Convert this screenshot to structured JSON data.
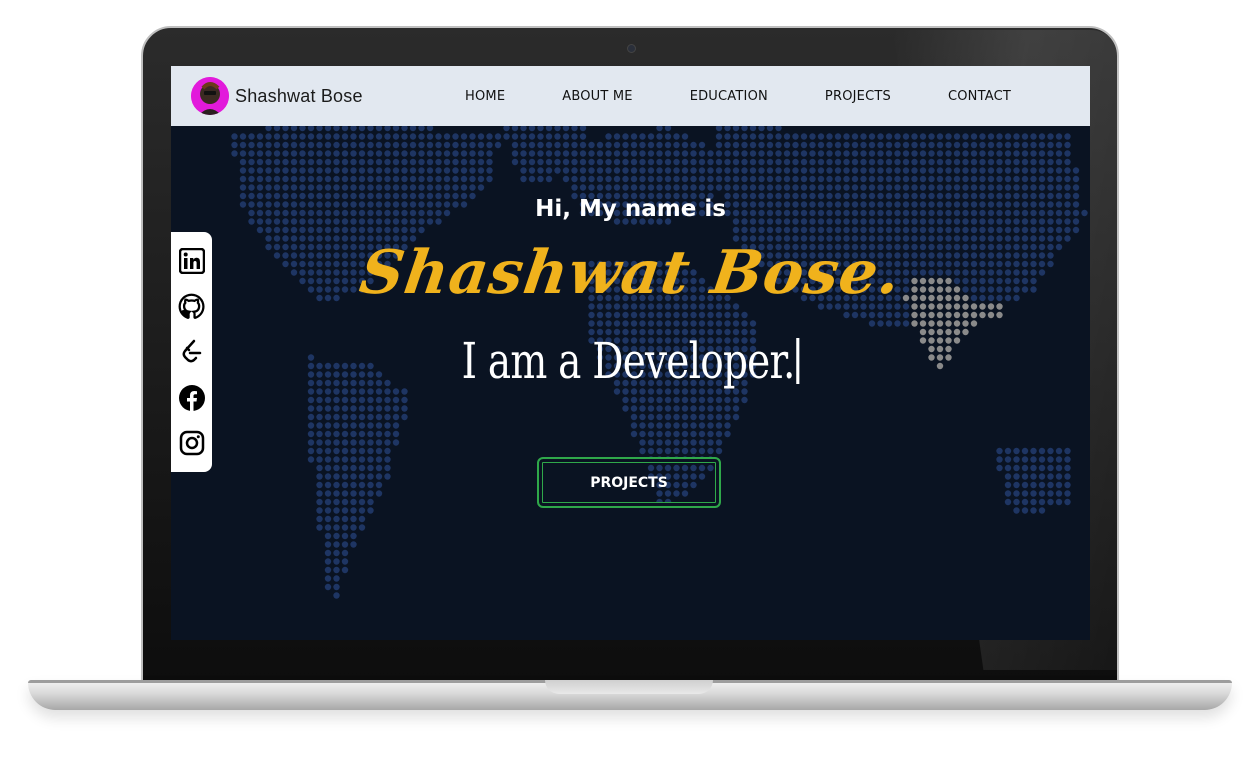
{
  "navbar": {
    "brand_name": "Shashwat Bose",
    "links": [
      "HOME",
      "ABOUT ME",
      "EDUCATION",
      "PROJECTS",
      "CONTACT"
    ]
  },
  "hero": {
    "greeting": "Hi, My name is",
    "name": "Shashwat Bose.",
    "role": "I am a Developer.",
    "button_label": "PROJECTS"
  },
  "social": {
    "icons": [
      "linkedin-icon",
      "github-icon",
      "leetcode-icon",
      "facebook-icon",
      "instagram-icon"
    ]
  },
  "colors": {
    "background": "#0a1322",
    "navbar": "#e2e8f0",
    "name_accent": "#f0b21c",
    "avatar_ring": "#e21adb",
    "button_border": "#2fa84a",
    "map_dots": "#1e3563",
    "highlight_country": "#8a8a8a"
  }
}
